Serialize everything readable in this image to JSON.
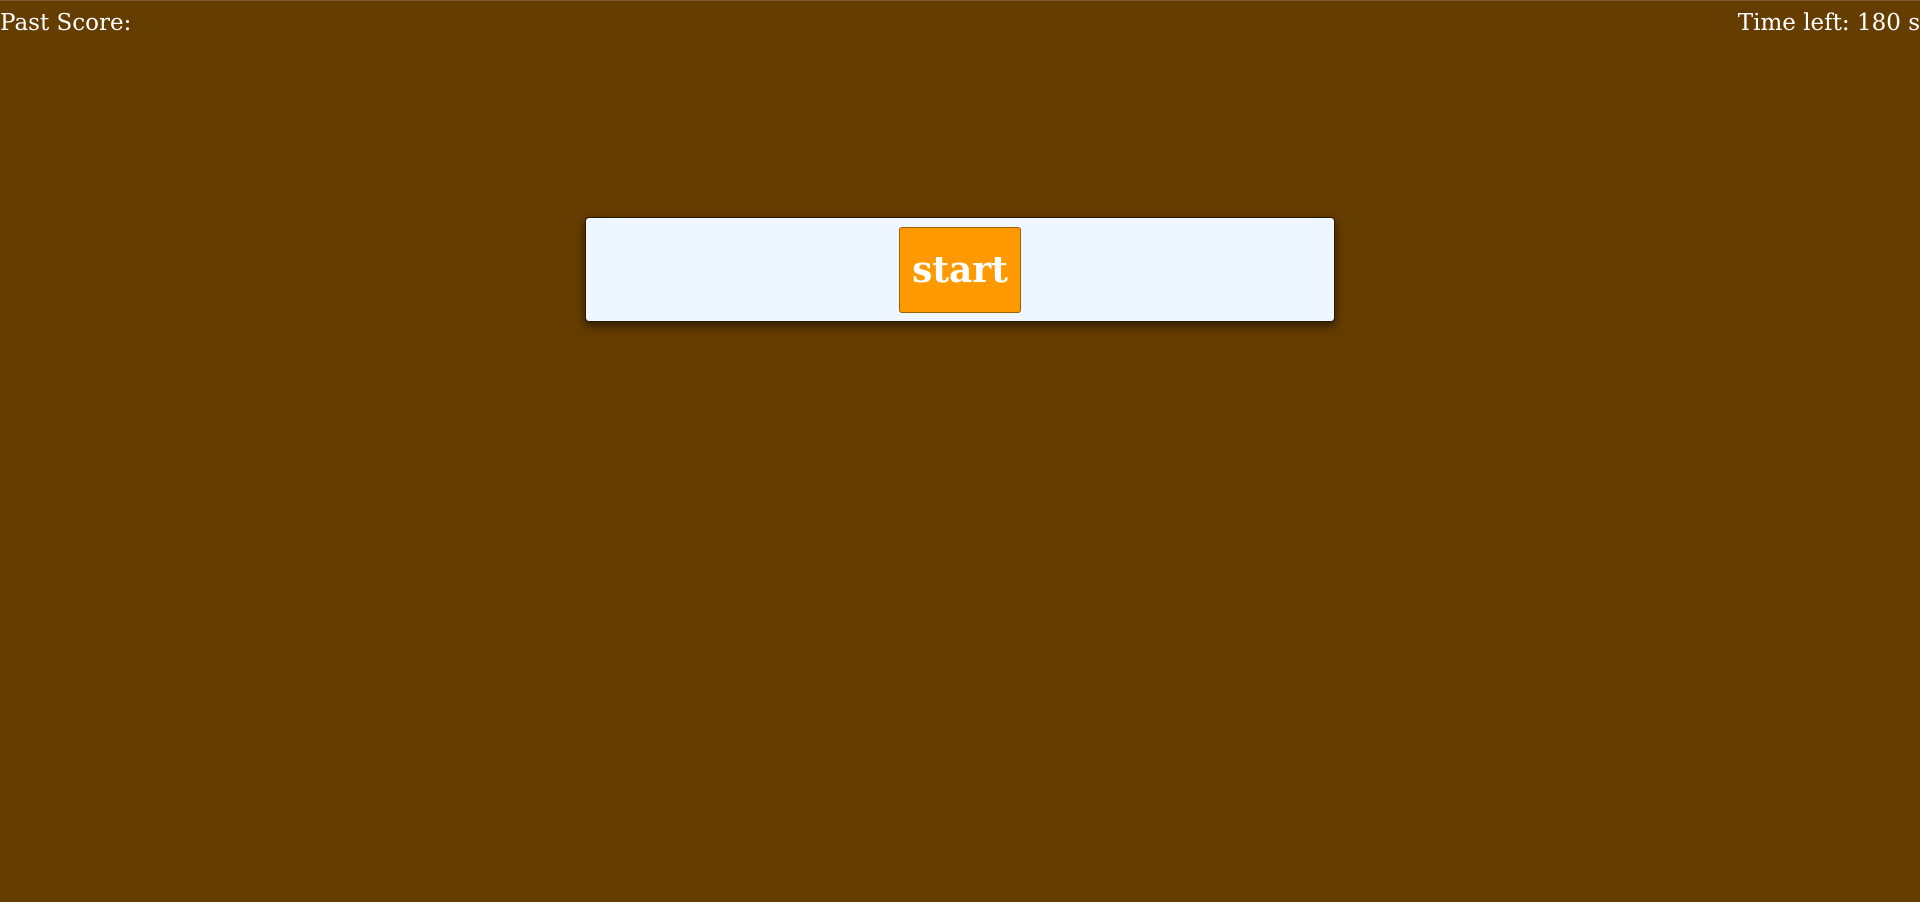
{
  "hud": {
    "past_score_label": "Past Score:",
    "time_left_label": "Time left: 180 s"
  },
  "panel": {
    "start_label": "start"
  },
  "colors": {
    "background": "#663d00",
    "panel": "#eef6ff",
    "button": "#ff9900",
    "text": "#ffffff"
  }
}
